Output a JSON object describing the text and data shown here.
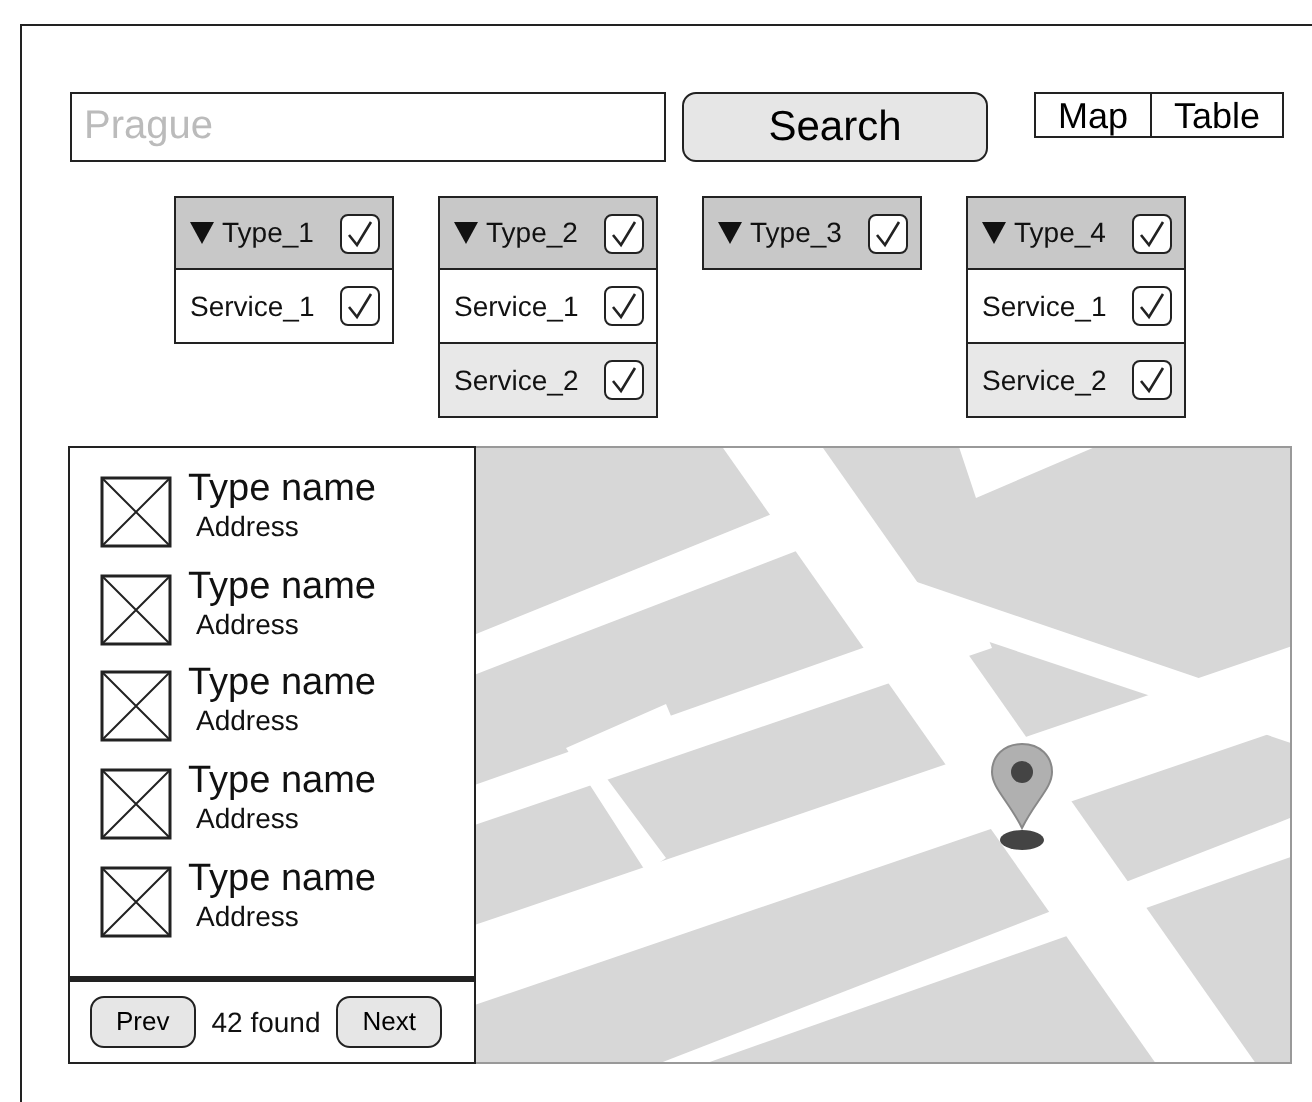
{
  "search": {
    "placeholder": "Prague"
  },
  "search_button": "Search",
  "view_toggle": [
    {
      "label": "Map"
    },
    {
      "label": "Table"
    }
  ],
  "filters": [
    {
      "type": "Type_1",
      "expanded": true,
      "checked": true,
      "services": [
        {
          "label": "Service_1",
          "checked": true
        }
      ]
    },
    {
      "type": "Type_2",
      "expanded": true,
      "checked": true,
      "services": [
        {
          "label": "Service_1",
          "checked": true
        },
        {
          "label": "Service_2",
          "checked": true
        }
      ]
    },
    {
      "type": "Type_3",
      "expanded": true,
      "checked": true
    },
    {
      "type": "Type_4",
      "expanded": true,
      "checked": true,
      "services": [
        {
          "label": "Service_1",
          "checked": true
        },
        {
          "label": "Service_2",
          "checked": true
        }
      ]
    }
  ],
  "results": [
    {
      "title": "Type name",
      "address": "Address"
    },
    {
      "title": "Type name",
      "address": "Address"
    },
    {
      "title": "Type name",
      "address": "Address"
    },
    {
      "title": "Type name",
      "address": "Address"
    },
    {
      "title": "Type name",
      "address": "Address"
    }
  ],
  "pager": {
    "prev": "Prev",
    "count": "42 found",
    "next": "Next"
  }
}
